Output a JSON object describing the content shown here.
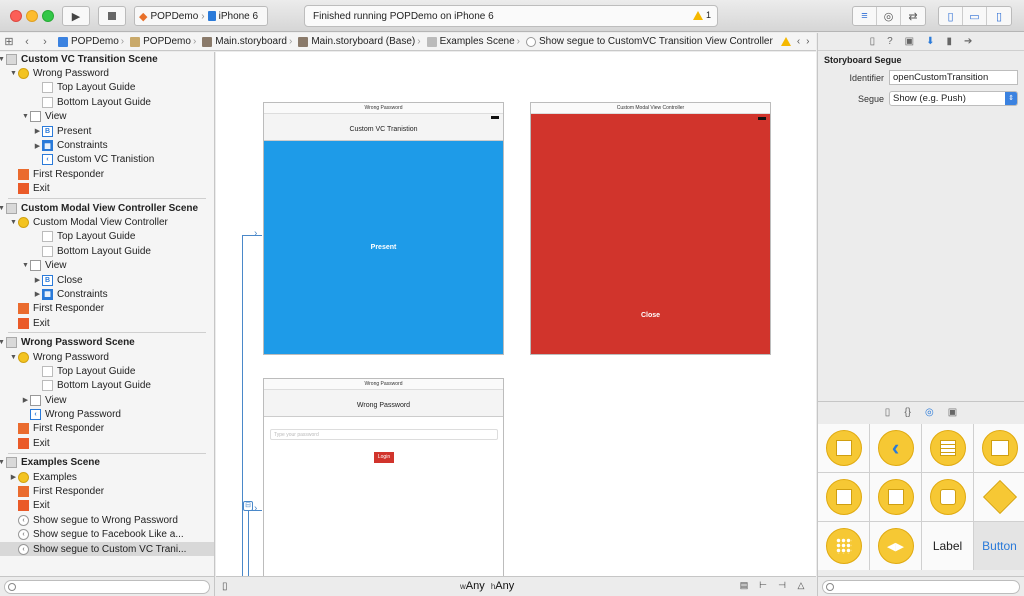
{
  "toolbar": {
    "scheme_project": "POPDemo",
    "scheme_device": "iPhone 6",
    "activity_status": "Finished running POPDemo on iPhone 6",
    "warning_count": "1"
  },
  "jumpbar": {
    "crumbs": [
      "POPDemo",
      "POPDemo",
      "Main.storyboard",
      "Main.storyboard (Base)",
      "Examples Scene",
      "Show segue to CustomVC Transition View Controller"
    ]
  },
  "navigator": {
    "rows": [
      {
        "label": "Custom VC Transition Scene",
        "type": "scene"
      },
      {
        "label": "Wrong Password",
        "type": "vc"
      },
      {
        "label": "Top Layout Guide",
        "type": "guide"
      },
      {
        "label": "Bottom Layout Guide",
        "type": "guide"
      },
      {
        "label": "View",
        "type": "view"
      },
      {
        "label": "Present",
        "type": "btn"
      },
      {
        "label": "Constraints",
        "type": "cons"
      },
      {
        "label": "Custom VC Tranistion",
        "type": "back"
      },
      {
        "label": "First Responder",
        "type": "fr"
      },
      {
        "label": "Exit",
        "type": "exit"
      },
      {
        "label": "Custom Modal View Controller Scene",
        "type": "scene"
      },
      {
        "label": "Custom Modal View Controller",
        "type": "vc"
      },
      {
        "label": "Top Layout Guide",
        "type": "guide"
      },
      {
        "label": "Bottom Layout Guide",
        "type": "guide"
      },
      {
        "label": "View",
        "type": "view"
      },
      {
        "label": "Close",
        "type": "btn"
      },
      {
        "label": "Constraints",
        "type": "cons"
      },
      {
        "label": "First Responder",
        "type": "fr"
      },
      {
        "label": "Exit",
        "type": "exit"
      },
      {
        "label": "Wrong Password Scene",
        "type": "scene"
      },
      {
        "label": "Wrong Password",
        "type": "vc"
      },
      {
        "label": "Top Layout Guide",
        "type": "guide"
      },
      {
        "label": "Bottom Layout Guide",
        "type": "guide"
      },
      {
        "label": "View",
        "type": "view"
      },
      {
        "label": "Wrong Password",
        "type": "back"
      },
      {
        "label": "First Responder",
        "type": "fr"
      },
      {
        "label": "Exit",
        "type": "exit"
      },
      {
        "label": "Examples Scene",
        "type": "scene"
      },
      {
        "label": "Examples",
        "type": "vc"
      },
      {
        "label": "First Responder",
        "type": "fr"
      },
      {
        "label": "Exit",
        "type": "exit"
      },
      {
        "label": "Show segue to Wrong Password",
        "type": "segue"
      },
      {
        "label": "Show segue to Facebook Like a...",
        "type": "segue"
      },
      {
        "label": "Show segue to Custom VC Trani...",
        "type": "segue"
      }
    ]
  },
  "canvas": {
    "scene1": {
      "title": "Wrong Password",
      "nav_title": "Custom VC Tranistion",
      "button": "Present"
    },
    "scene2": {
      "title": "Custom Modal View Controller",
      "button": "Close"
    },
    "scene3": {
      "title": "Wrong Password",
      "nav_title": "Wrong Password",
      "placeholder": "Type your password",
      "button": "Login"
    },
    "size_w": "Any",
    "size_h": "Any"
  },
  "inspector": {
    "title": "Storyboard Segue",
    "identifier_label": "Identifier",
    "identifier_value": "openCustomTransition",
    "segue_label": "Segue",
    "segue_value": "Show (e.g. Push)"
  },
  "library": {
    "label_item": "Label",
    "button_item": "Button"
  },
  "colors": {
    "present_blue": "#1e9be8",
    "modal_red": "#d1342c",
    "login_red": "#d1342c",
    "accent": "#2a7ad9"
  }
}
